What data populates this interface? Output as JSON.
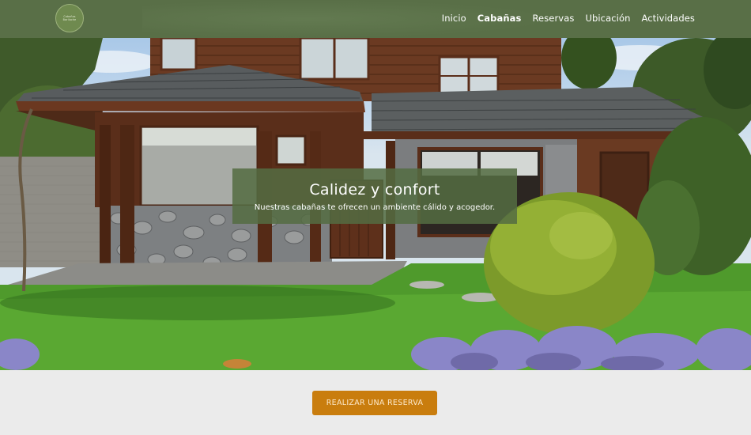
{
  "brand": {
    "logo_line1": "Cabañas",
    "logo_line2": "Bariloche"
  },
  "nav": {
    "items": [
      {
        "label": "Inicio",
        "active": false
      },
      {
        "label": "Cabañas",
        "active": true
      },
      {
        "label": "Reservas",
        "active": false
      },
      {
        "label": "Ubicación",
        "active": false
      },
      {
        "label": "Actividades",
        "active": false
      }
    ]
  },
  "hero": {
    "title": "Calidez y confort",
    "subtitle": "Nuestras cabañas te ofrecen un ambiente cálido y acogedor."
  },
  "cta": {
    "label": "REALIZAR UNA RESERVA"
  },
  "colors": {
    "header_bg": "#596f47",
    "overlay_bg": "#546c42",
    "cta_bg": "#c97d0e",
    "page_bg": "#ebebeb"
  }
}
